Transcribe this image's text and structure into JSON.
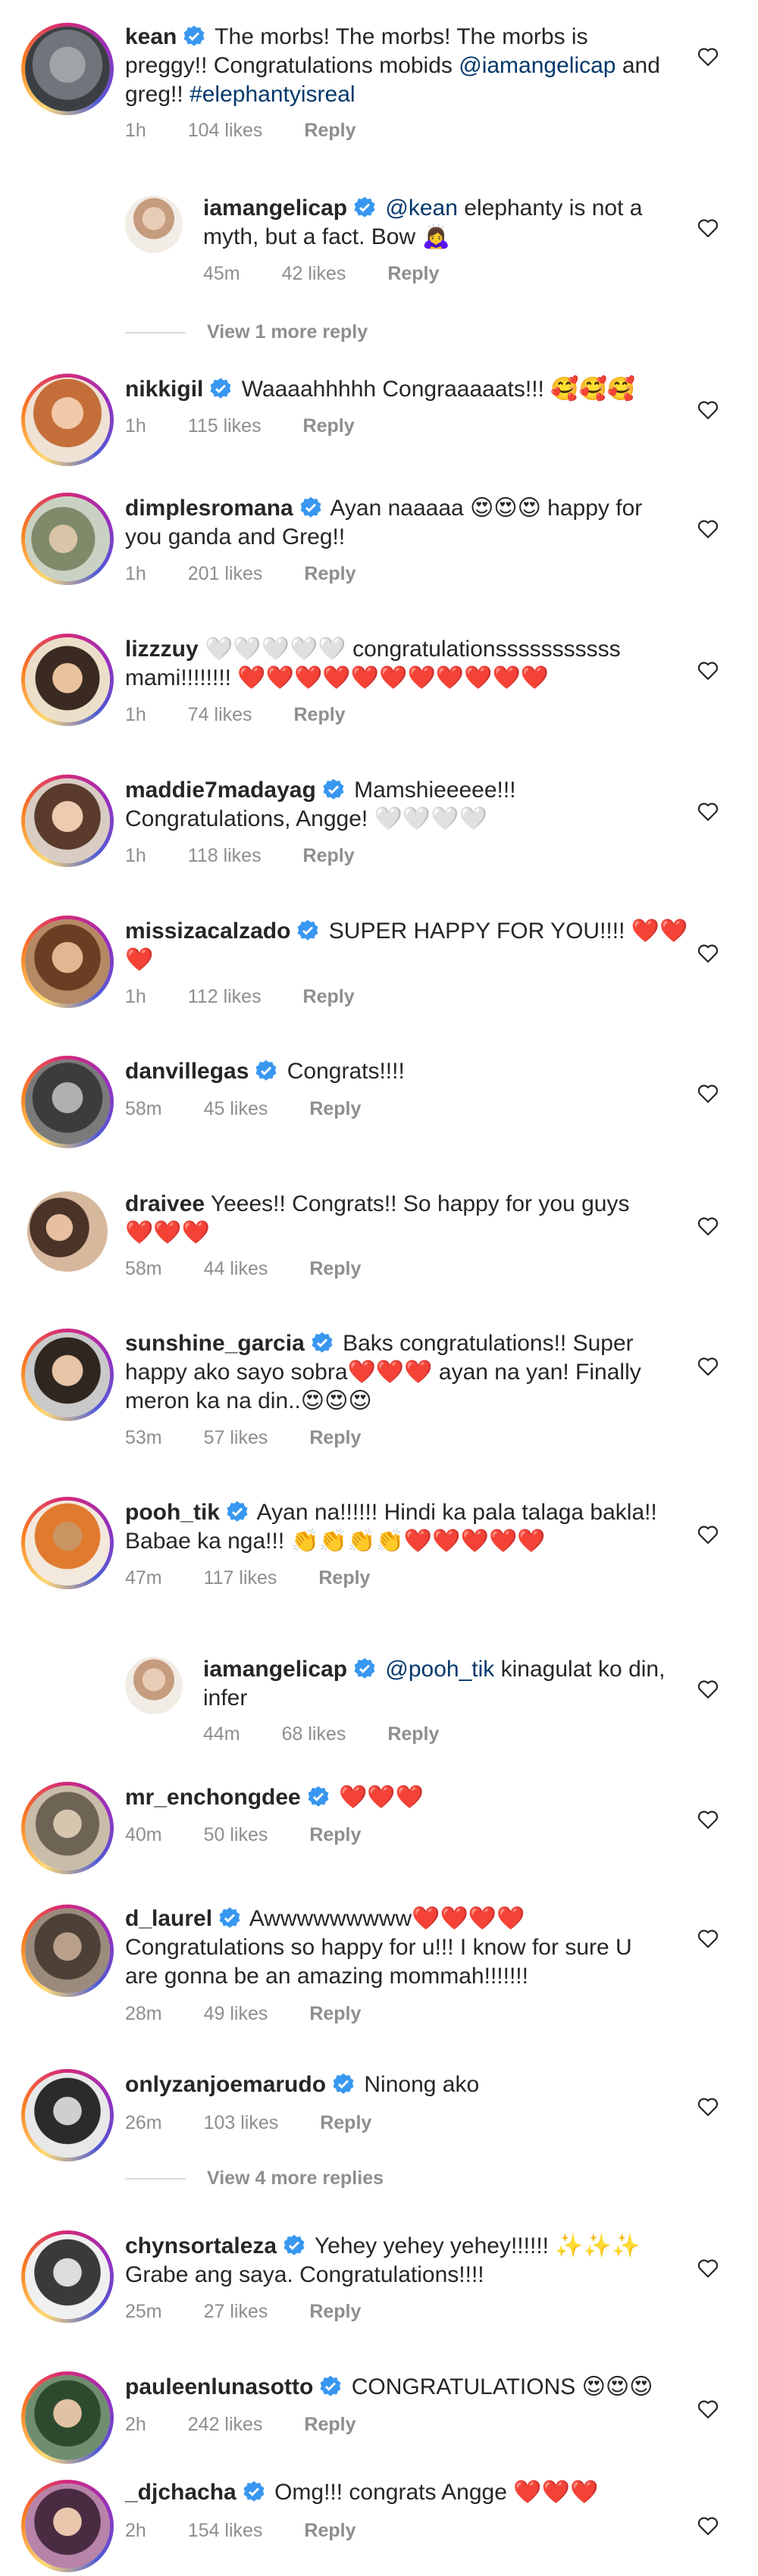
{
  "labels": {
    "reply": "Reply"
  },
  "colors": {
    "link": "#00376b",
    "meta": "#8e8e8e",
    "heart_outline": "#262626",
    "verified_blue": "#3897f0"
  },
  "comments": [
    {
      "user": "kean",
      "verified": true,
      "line1": " The morbs! The morbs! The morbs is",
      "line2": "preggy!! Congratulations mobids ",
      "mention2": "@iamangelicap",
      "after2": " and",
      "line3": "greg!! ",
      "tag3": "#elephantyisreal",
      "time": "1h",
      "likes": "104 likes",
      "icon": "avatar-kean-icon"
    },
    {
      "user": "iamangelicap",
      "verified": true,
      "mention1": " @kean",
      "line1": " elephanty is not a",
      "line2": "myth, but a fact. Bow 🙇‍♀️",
      "time": "45m",
      "likes": "42 likes",
      "icon": "avatar-iamangelicap-icon"
    },
    {
      "view_replies": "View 1 more reply"
    },
    {
      "user": "nikkigil",
      "verified": true,
      "line1": " Waaaahhhhh Congraaaaats!!! 🥰🥰🥰",
      "time": "1h",
      "likes": "115 likes"
    },
    {
      "user": "dimplesromana",
      "verified": true,
      "line1": " Ayan naaaaa 😍😍😍 happy for",
      "line2": "you ganda and Greg!!",
      "time": "1h",
      "likes": "201 likes"
    },
    {
      "user": "lizzzuy",
      "verified": false,
      "line1": " 🤍🤍🤍🤍🤍 congratulationsssssssssss",
      "line2": "mami!!!!!!!! ❤️❤️❤️❤️❤️❤️❤️❤️❤️❤️❤️",
      "time": "1h",
      "likes": "74 likes"
    },
    {
      "user": "maddie7madayag",
      "verified": true,
      "line1": " Mamshieeeee!!!",
      "line2": "Congratulations, Angge! 🤍🤍🤍🤍",
      "time": "1h",
      "likes": "118 likes"
    },
    {
      "user": "missizacalzado",
      "verified": true,
      "line1": " SUPER HAPPY FOR YOU!!!! ❤️❤️",
      "line2": "❤️",
      "time": "1h",
      "likes": "112 likes"
    },
    {
      "user": "danvillegas",
      "verified": true,
      "line1": " Congrats!!!!",
      "time": "58m",
      "likes": "45 likes"
    },
    {
      "user": "draivee",
      "verified": false,
      "line1": " Yeees!! Congrats!! So happy for you guys",
      "line2": "❤️❤️❤️",
      "time": "58m",
      "likes": "44 likes"
    },
    {
      "user": "sunshine_garcia",
      "verified": true,
      "line1": " Baks congratulations!! Super",
      "line2": "happy ako sayo sobra❤️❤️❤️ ayan na yan! Finally",
      "line3": "meron ka na din..😍😍😍",
      "time": "53m",
      "likes": "57 likes"
    },
    {
      "user": "pooh_tik",
      "verified": true,
      "line1": " Ayan na!!!!!! Hindi ka pala talaga bakla!!",
      "line2": "Babae ka nga!!! 👏👏👏👏❤️❤️❤️❤️❤️",
      "time": "47m",
      "likes": "117 likes"
    },
    {
      "user": "iamangelicap",
      "verified": true,
      "mention1": " @pooh_tik",
      "line1": " kinagulat ko din,",
      "line2": "infer",
      "time": "44m",
      "likes": "68 likes"
    },
    {
      "user": "mr_enchongdee",
      "verified": true,
      "line1": " ❤️❤️❤️",
      "time": "40m",
      "likes": "50 likes"
    },
    {
      "user": "d_laurel",
      "verified": true,
      "line1": " Awwwwwwwww❤️❤️❤️❤️",
      "line2": "Congratulations so happy for u!!! I know for sure U",
      "line3": "are gonna be an amazing mommah!!!!!!!",
      "time": "28m",
      "likes": "49 likes"
    },
    {
      "user": "onlyzanjoemarudo",
      "verified": true,
      "line1": " Ninong ako",
      "time": "26m",
      "likes": "103 likes"
    },
    {
      "view_replies": "View 4 more replies"
    },
    {
      "user": "chynsortaleza",
      "verified": true,
      "line1": " Yehey yehey yehey!!!!!! ✨✨✨",
      "line2": "Grabe ang saya. Congratulations!!!!",
      "time": "25m",
      "likes": "27 likes"
    },
    {
      "user": "pauleenlunasotto",
      "verified": true,
      "line1": " CONGRATULATIONS 😍😍😍",
      "time": "2h",
      "likes": "242 likes"
    },
    {
      "user": "_djchacha",
      "verified": true,
      "line1": " Omg!!! congrats Angge ❤️❤️❤️",
      "time": "2h",
      "likes": "154 likes"
    }
  ]
}
